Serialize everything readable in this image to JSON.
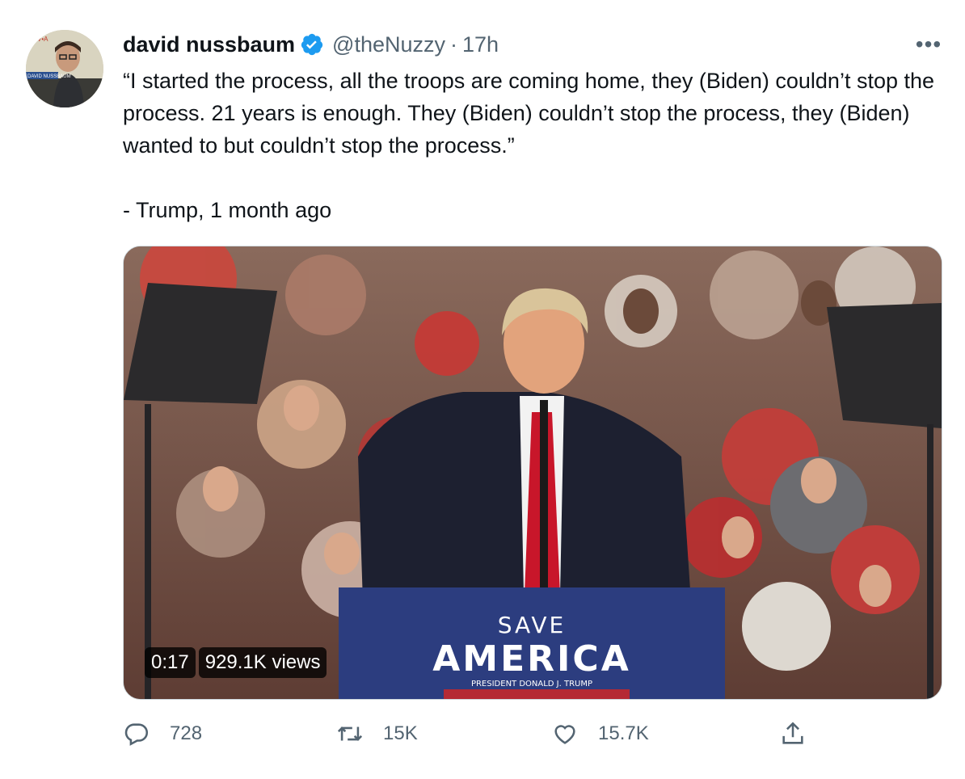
{
  "author": {
    "display_name": "david nussbaum",
    "handle": "@theNuzzy",
    "separator": "·",
    "timestamp": "17h",
    "verified": true,
    "avatar_caption": "DAVID NUSSBAUM"
  },
  "tweet": {
    "line1": "“I started the process, all the troops are coming home, they (Biden) couldn’t stop the process. 21 years is enough. They (Biden) couldn’t stop the process, they (Biden) wanted to but couldn’t stop the process.”",
    "line2": "- Trump, 1 month ago"
  },
  "video": {
    "duration": "0:17",
    "views": "929.1K views",
    "podium_line1": "SAVE",
    "podium_line2": "AMERICA",
    "podium_line3": "PRESIDENT DONALD J. TRUMP"
  },
  "actions": {
    "replies": "728",
    "retweets": "15K",
    "likes": "15.7K"
  },
  "colors": {
    "verified": "#1d9bf0",
    "secondary_text": "#536471",
    "podium_blue": "#2c3d7f"
  },
  "icons": [
    "more-icon",
    "verified-icon",
    "reply-icon",
    "retweet-icon",
    "like-icon",
    "share-icon"
  ]
}
